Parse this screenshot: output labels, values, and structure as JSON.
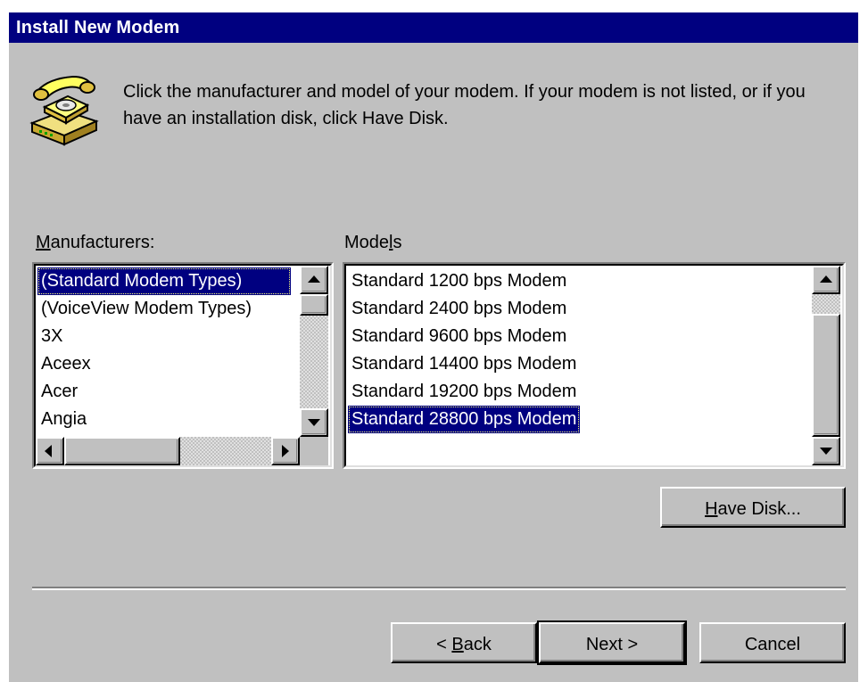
{
  "window": {
    "title": "Install New Modem",
    "instructions": "Click the manufacturer and model of your modem. If your modem is not listed, or if you have an installation disk, click Have Disk."
  },
  "icons": {
    "modem": "telephone-modem-icon",
    "scroll_up": "arrow-up-icon",
    "scroll_down": "arrow-down-icon",
    "scroll_left": "arrow-left-icon",
    "scroll_right": "arrow-right-icon"
  },
  "colors": {
    "title_bar": "#000080",
    "dialog_face": "#c0c0c0",
    "selection": "#000080",
    "list_background": "#ffffff"
  },
  "manufacturers": {
    "label_pre": "",
    "label_accel": "M",
    "label_post": "anufacturers:",
    "items": [
      "(Standard Modem Types)",
      "(VoiceView Modem Types)",
      "3X",
      "Aceex",
      "Acer",
      "Angia"
    ],
    "selected": "(Standard Modem Types)"
  },
  "models": {
    "label_pre": "Mode",
    "label_accel": "l",
    "label_post": "s",
    "items": [
      "Standard  1200 bps Modem",
      "Standard  2400 bps Modem",
      "Standard  9600 bps Modem",
      "Standard 14400 bps Modem",
      "Standard 19200 bps Modem",
      "Standard 28800 bps Modem"
    ],
    "selected": "Standard 28800 bps Modem"
  },
  "buttons": {
    "have_disk_accel": "H",
    "have_disk_rest": "ave Disk...",
    "back_prefix": "< ",
    "back_accel": "B",
    "back_rest": "ack",
    "next": "Next >",
    "cancel": "Cancel"
  }
}
